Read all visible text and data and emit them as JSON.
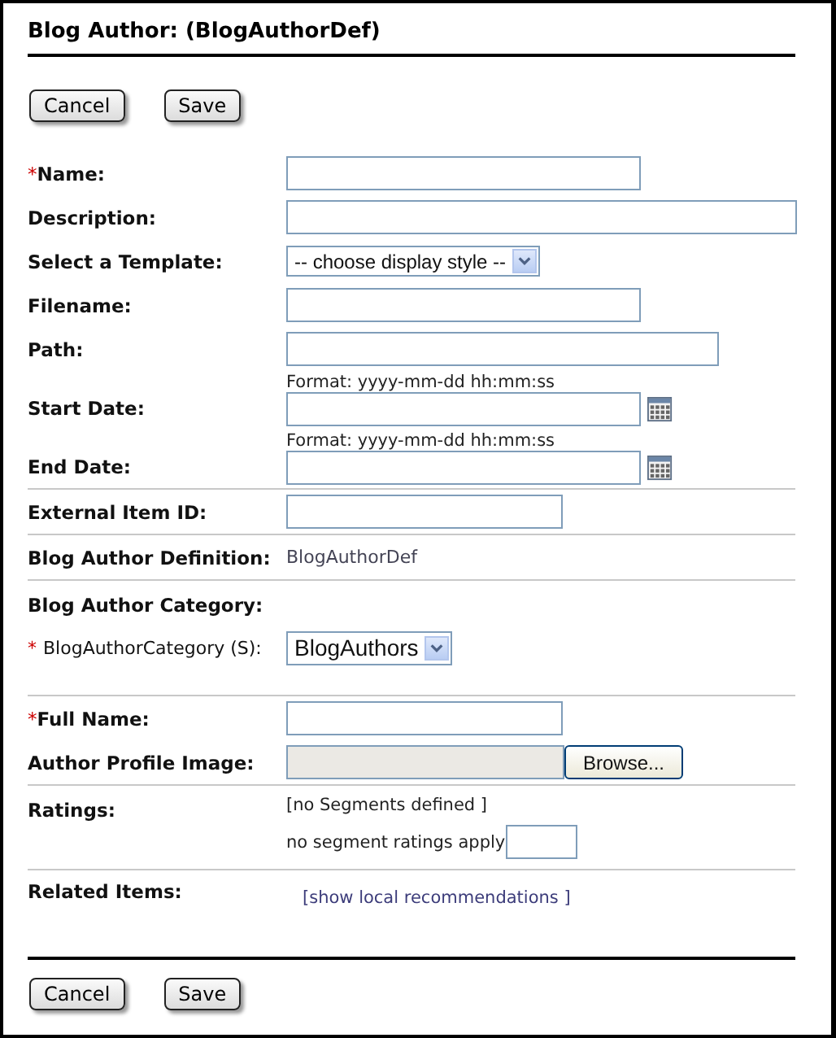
{
  "title": "Blog Author: (BlogAuthorDef)",
  "top_buttons": [
    "Cancel",
    "Save"
  ],
  "sections": [
    {
      "rows": [
        {
          "kind": "text",
          "label": "Name:",
          "required_mark": "*"
        },
        {
          "kind": "text",
          "label": "Description:"
        },
        {
          "kind": "select",
          "label": "Select a Template:",
          "value": "-- choose display style --"
        },
        {
          "kind": "text",
          "label": "Filename:"
        },
        {
          "kind": "text",
          "label": "Path:"
        },
        {
          "kind": "date",
          "label": "Start Date:",
          "hint": "Format: yyyy-mm-dd hh:mm:ss"
        },
        {
          "kind": "date",
          "label": "End Date:",
          "hint": "Format: yyyy-mm-dd hh:mm:ss"
        }
      ]
    },
    {
      "rows": [
        {
          "kind": "text",
          "label": "External Item ID:"
        }
      ]
    },
    {
      "rows": [
        {
          "kind": "static",
          "label": "Blog Author Definition:",
          "value": "BlogAuthorDef"
        }
      ]
    },
    {
      "rows": [
        {
          "kind": "header",
          "label": "Blog Author Category:"
        },
        {
          "kind": "subselect",
          "label": "BlogAuthorCategory (S):",
          "required_mark": "*",
          "value": "BlogAuthors"
        }
      ]
    },
    {
      "rows": [
        {
          "kind": "text",
          "label": "Full Name:",
          "required_mark": "*"
        },
        {
          "kind": "file",
          "label": "Author Profile Image:",
          "button": "Browse..."
        }
      ]
    },
    {
      "rows": [
        {
          "kind": "ratings",
          "label": "Ratings:",
          "note": "[no Segments defined ]",
          "apply": "no segment ratings apply"
        }
      ]
    },
    {
      "rows": [
        {
          "kind": "link",
          "label": "Related Items:",
          "value": "[show local recommendations ]"
        }
      ]
    }
  ],
  "bottom_buttons": [
    "Cancel",
    "Save"
  ]
}
